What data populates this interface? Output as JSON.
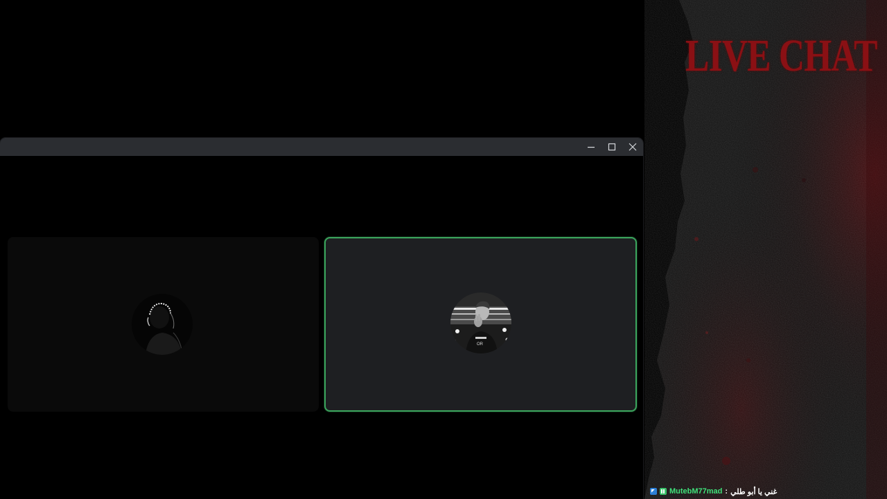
{
  "overlay": {
    "title": "LIVE CHAT",
    "colors": {
      "title": "#8a1014",
      "background": "#141414",
      "glow": "#5a0a0e"
    }
  },
  "chat": {
    "messages": [
      {
        "badges": [
          "moderator-badge-icon",
          "broadcaster-badge-icon"
        ],
        "username": "MutebM77mad",
        "separator": ":",
        "text": "غني يا أبو طلي",
        "username_color": "#3fe27a"
      }
    ]
  },
  "window": {
    "controls": {
      "minimize": "minimize-icon",
      "maximize": "maximize-icon",
      "close": "close-icon"
    },
    "colors": {
      "titlebar": "#2b2d31",
      "speaking_border": "#3ba55d",
      "tile_active_bg": "#1e1f22",
      "tile_idle_bg": "#0a0a0a"
    },
    "participants": [
      {
        "avatar": "silhouette-avatar",
        "speaking": false
      },
      {
        "avatar": "driver-photo-avatar",
        "speaking": true
      }
    ]
  }
}
